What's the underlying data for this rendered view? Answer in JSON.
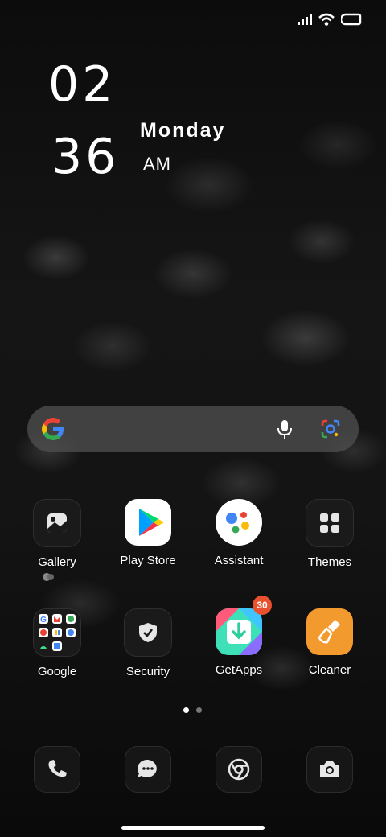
{
  "status_bar": {
    "icons": [
      "signal-icon",
      "wifi-icon",
      "battery-icon"
    ]
  },
  "clock": {
    "hour": "02",
    "minute": "36",
    "day": "Monday",
    "ampm": "AM"
  },
  "search_bar": {
    "icons": [
      "google-logo-icon",
      "microphone-icon",
      "google-lens-icon"
    ]
  },
  "apps": [
    {
      "label": "Gallery"
    },
    {
      "label": "Play Store"
    },
    {
      "label": "Assistant"
    },
    {
      "label": "Themes"
    },
    {
      "label": "Google"
    },
    {
      "label": "Security"
    },
    {
      "label": "GetApps",
      "badge": "30"
    },
    {
      "label": "Cleaner"
    }
  ],
  "page_indicator": {
    "pages": 2,
    "current": 1
  },
  "dock": {
    "icons": [
      "phone-icon",
      "messages-icon",
      "chrome-icon",
      "camera-icon"
    ]
  },
  "colors": {
    "badge": "#e8502e",
    "cleaner": "#f29a2e",
    "dock_bg": "#161616"
  }
}
